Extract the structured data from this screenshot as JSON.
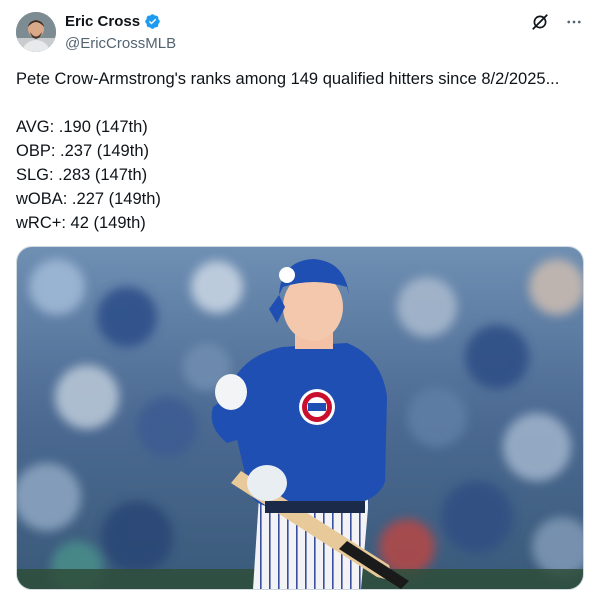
{
  "author": {
    "display_name": "Eric Cross",
    "handle": "@EricCrossMLB",
    "verified": true,
    "avatar_icon": "avatar-photo"
  },
  "actions": {
    "grok_icon": "grok-icon",
    "more_icon": "more-icon"
  },
  "tweet": {
    "intro": "Pete Crow-Armstrong's ranks among 149 qualified hitters since 8/2/2025...",
    "stats": [
      "AVG: .190 (147th)",
      "OBP: .237 (149th)",
      "SLG: .283 (147th)",
      "wOBA: .227 (149th)",
      "wRC+: 42 (149th)"
    ]
  },
  "media": {
    "image_icon": "photo-baseball-player"
  },
  "colors": {
    "verified": "#1d9bf0",
    "text": "#0f1419",
    "secondary": "#536471",
    "cubs_blue": "#1f4fb3"
  }
}
